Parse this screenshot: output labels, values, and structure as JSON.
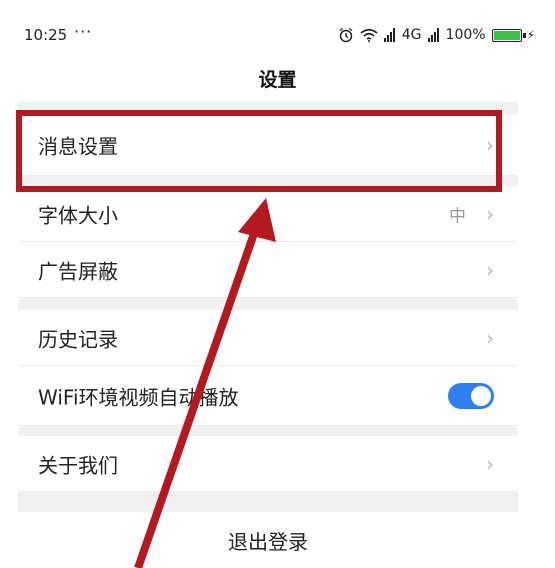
{
  "status_bar": {
    "time": "10:25",
    "more": "···",
    "network": "4G",
    "battery": "100%",
    "battery_level": 1.0,
    "icons": [
      "alarm-icon",
      "wifi-icon",
      "signal-icon",
      "signal-icon",
      "battery-icon",
      "charging-icon"
    ]
  },
  "title": "设置",
  "settings": {
    "message_settings": {
      "label": "消息设置"
    },
    "font_size": {
      "label": "字体大小",
      "value": "中"
    },
    "ad_block": {
      "label": "广告屏蔽"
    },
    "history": {
      "label": "历史记录"
    },
    "wifi_autoplay": {
      "label": "WiFi环境视频自动播放",
      "enabled": true
    },
    "about": {
      "label": "关于我们"
    },
    "logout": {
      "label": "退出登录"
    },
    "chevron": "›"
  },
  "colors": {
    "toggle_on": "#2f7ff0",
    "annotation": "#b3191f",
    "battery_fill": "#3cc04a"
  }
}
